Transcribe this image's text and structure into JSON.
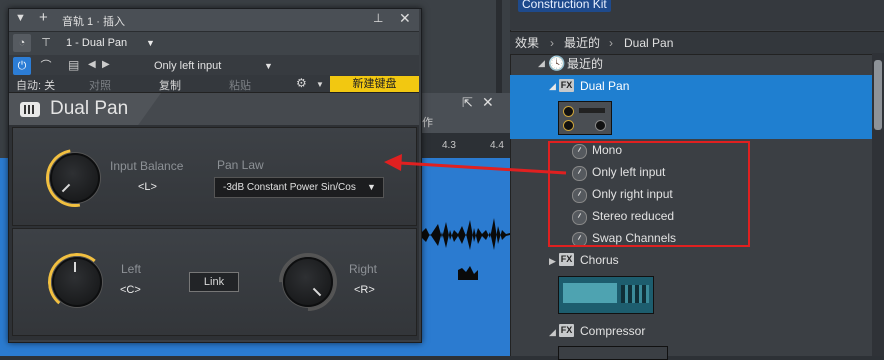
{
  "daw": {
    "ruler": [
      "4.3",
      "4.4"
    ],
    "bg_strip_label": "作"
  },
  "plugin": {
    "title": "音轨 1 · 插入",
    "preset": "1 - Dual Pan",
    "input_mode": "Only left input",
    "auto_label": "自动: 关",
    "compare_label": "对照",
    "copy_label": "复制",
    "paste_label": "粘贴",
    "new_keyboard_label": "新建键盘",
    "name": "Dual Pan",
    "input_balance_label": "Input Balance",
    "input_balance_value": "<L>",
    "pan_law_label": "Pan Law",
    "pan_law_value": "-3dB Constant Power Sin/Cos",
    "left_label": "Left",
    "left_value": "<C>",
    "right_label": "Right",
    "right_value": "<R>",
    "link_label": "Link"
  },
  "browser": {
    "kit_tag": "Construction Kit",
    "breadcrumb": [
      "效果",
      "最近的",
      "Dual Pan"
    ],
    "recent_label": "最近的",
    "items": [
      {
        "label": "Dual Pan",
        "selected": true
      },
      {
        "label": "Chorus"
      },
      {
        "label": "Compressor"
      }
    ],
    "presets": [
      "Mono",
      "Only left input",
      "Only right input",
      "Stereo reduced",
      "Swap Channels"
    ],
    "fx_badge": "FX"
  },
  "colors": {
    "accent": "#1f7fd0",
    "highlight": "#e02020",
    "knob_ring": "#f2c040",
    "keyboard_btn": "#f2c811"
  }
}
